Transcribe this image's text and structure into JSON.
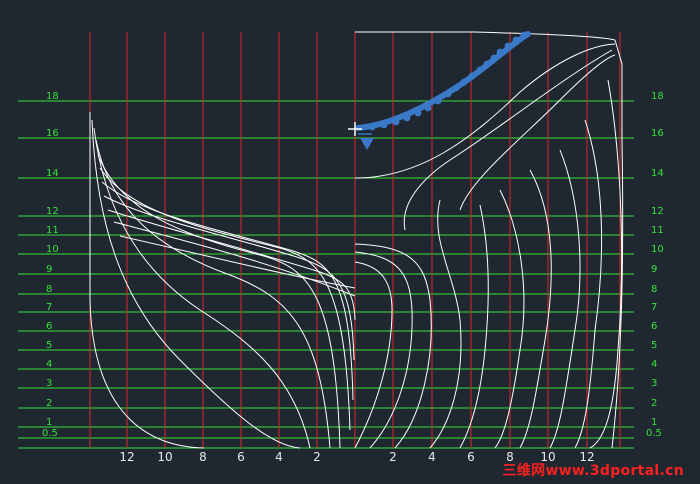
{
  "watermark": "三维网www.3dportal.cn",
  "colors": {
    "background": "#1f2730",
    "waterline": "#35e03a",
    "station": "#d42a2a",
    "section": "#ffffff",
    "cursor": "#3a78c8"
  },
  "waterlines": [
    {
      "label_left": "18",
      "label_right": "18"
    },
    {
      "label_left": "16",
      "label_right": "16"
    },
    {
      "label_left": "14",
      "label_right": "14"
    },
    {
      "label_left": "12",
      "label_right": "12"
    },
    {
      "label_left": "11",
      "label_right": "11"
    },
    {
      "label_left": "10",
      "label_right": "10"
    },
    {
      "label_left": "9",
      "label_right": "9"
    },
    {
      "label_left": "8",
      "label_right": "8"
    },
    {
      "label_left": "7",
      "label_right": "7"
    },
    {
      "label_left": "6",
      "label_right": "6"
    },
    {
      "label_left": "5",
      "label_right": "5"
    },
    {
      "label_left": "4",
      "label_right": "4"
    },
    {
      "label_left": "3",
      "label_right": "3"
    },
    {
      "label_left": "2",
      "label_right": "2"
    },
    {
      "label_left": "1",
      "label_right": "1"
    },
    {
      "label_left": "0.5",
      "label_right": "0.5"
    }
  ],
  "station_labels_left": [
    "12",
    "10",
    "8",
    "6",
    "4",
    "2"
  ],
  "station_labels_right": [
    "2",
    "4",
    "6",
    "8",
    "10",
    "12"
  ],
  "icons": [
    "crosshair-cursor-icon",
    "ucs-triangle-icon"
  ]
}
